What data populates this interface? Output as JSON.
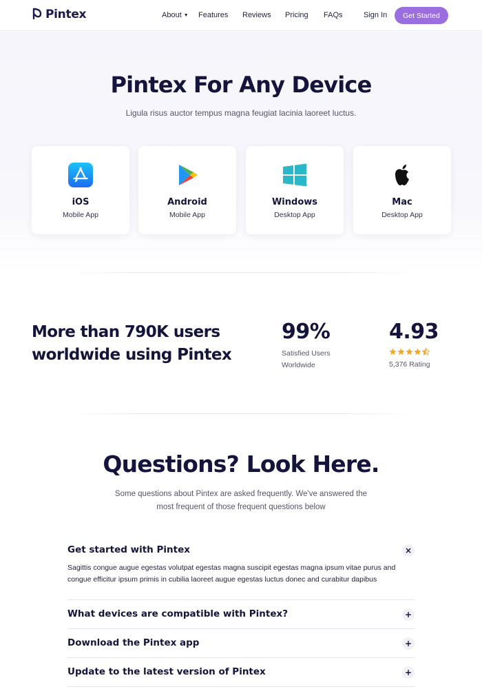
{
  "nav": {
    "brand": "Pintex",
    "links": [
      "About",
      "Features",
      "Reviews",
      "Pricing",
      "FAQs"
    ],
    "signin": "Sign In",
    "cta": "Get Started"
  },
  "hero": {
    "title": "Pintex For Any Device",
    "subtitle": "Ligula risus auctor tempus magna feugiat lacinia laoreet luctus."
  },
  "devices": [
    {
      "name": "iOS",
      "type": "Mobile App",
      "icon": "app-store-icon"
    },
    {
      "name": "Android",
      "type": "Mobile App",
      "icon": "google-play-icon"
    },
    {
      "name": "Windows",
      "type": "Desktop App",
      "icon": "windows-icon"
    },
    {
      "name": "Mac",
      "type": "Desktop App",
      "icon": "apple-icon"
    }
  ],
  "stats": {
    "heading_line1": "More than 790K users",
    "heading_line2": "worldwide using Pintex",
    "satisfied_value": "99%",
    "satisfied_line1": "Satisfied Users",
    "satisfied_line2": "Worldwide",
    "rating_value": "4.93",
    "rating_stars": 4.5,
    "rating_label": "5,376 Rating"
  },
  "faq": {
    "title": "Questions? Look Here.",
    "subtitle_line1": "Some questions about Pintex are asked frequently. We've answered the",
    "subtitle_line2": "most frequent of those frequent questions below",
    "items": [
      {
        "question": "Get started with Pintex",
        "answer_line1": "Sagittis congue augue egestas volutpat egestas magna suscipit egestas magna ipsum vitae purus and",
        "answer_line2": "congue efficitur ipsum primis in cubilia laoreet augue egestas luctus donec and curabitur dapibus",
        "expanded": true,
        "toggle": "×"
      },
      {
        "question": "What devices are compatible with Pintex?",
        "expanded": false,
        "toggle": "+"
      },
      {
        "question": "Download the Pintex app",
        "expanded": false,
        "toggle": "+"
      },
      {
        "question": "Update to the latest version of Pintex",
        "expanded": false,
        "toggle": "+"
      }
    ]
  },
  "colors": {
    "accent": "#9a6ede",
    "heading": "#14143c",
    "star": "#f5a623"
  }
}
